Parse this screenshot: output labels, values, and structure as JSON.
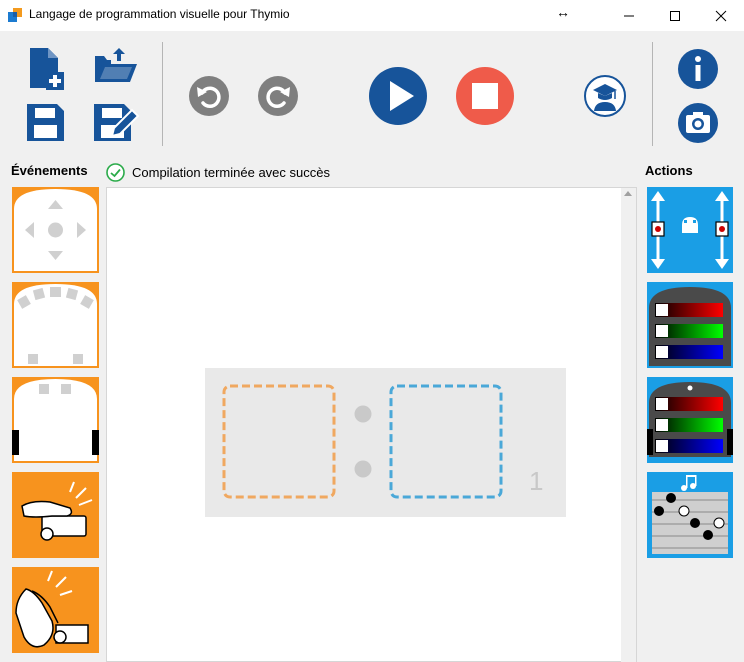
{
  "window": {
    "title": "Langage de programmation visuelle pour Thymio",
    "resize_glyph": "↔",
    "controls": [
      "minimize-icon",
      "maximize-icon",
      "close-icon"
    ]
  },
  "toolbar": {
    "buttons": [
      "new-file-icon",
      "open-folder-icon",
      "save-icon",
      "save-as-icon",
      "undo-icon",
      "redo-icon",
      "run-icon",
      "stop-icon",
      "teacher-mode-icon",
      "info-icon",
      "screenshot-icon"
    ]
  },
  "events": {
    "label": "Événements",
    "blocks": [
      "buttons-event",
      "front-proximity-event",
      "ground-proximity-event",
      "tap-event",
      "clap-event"
    ]
  },
  "status": {
    "icon": "check-circle-icon",
    "text": "Compilation terminée avec succès"
  },
  "actions": {
    "label": "Actions",
    "blocks": [
      "motors-action",
      "top-color-action",
      "bottom-color-action",
      "music-action"
    ]
  },
  "program": {
    "pair_number": "1"
  },
  "colors": {
    "orange": "#f7931e",
    "blue": "#1a9ee5",
    "dark_blue": "#17549a",
    "stop_red": "#ef5b4a",
    "event_dash": "#f0a860",
    "action_dash": "#4aa8d8"
  }
}
